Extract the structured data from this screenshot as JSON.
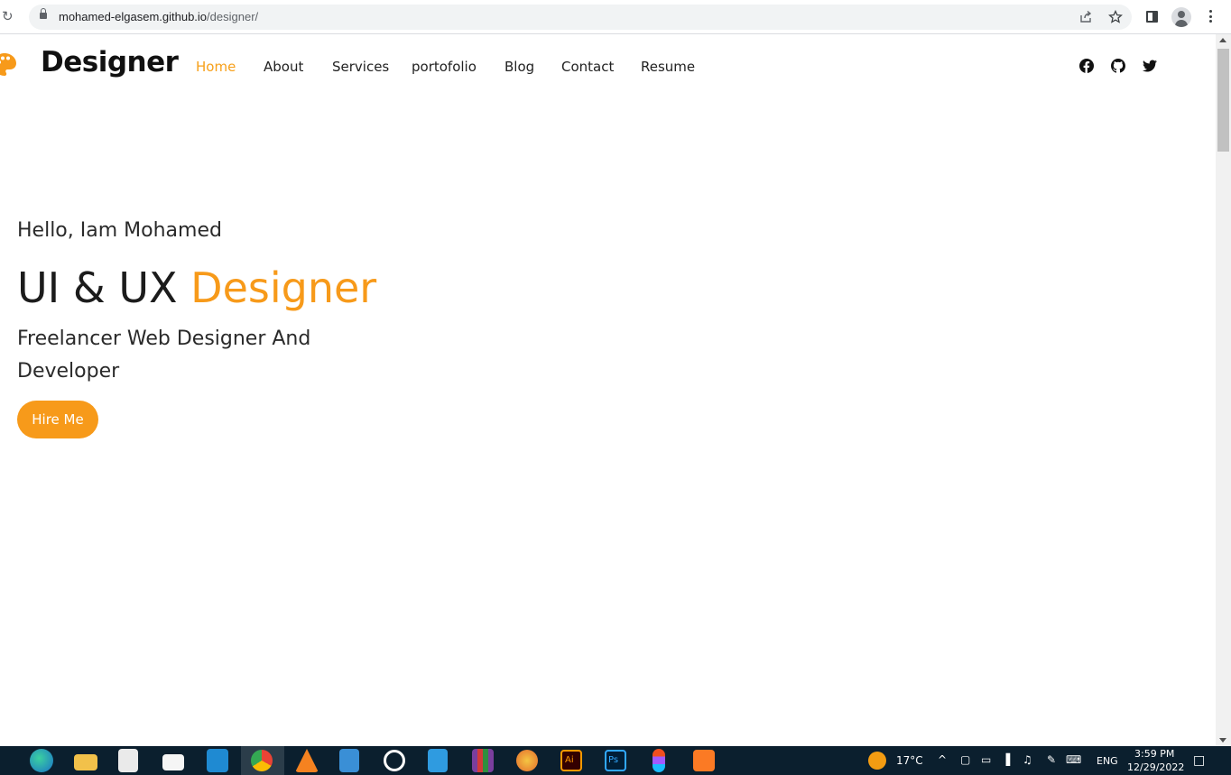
{
  "browser": {
    "url_host": "mohamed-elgasem.github.io",
    "url_path": "/designer/"
  },
  "site": {
    "logo": "Designer",
    "nav": [
      "Home",
      "About",
      "Services",
      "portofolio",
      "Blog",
      "Contact",
      "Resume"
    ],
    "active_nav": "Home",
    "social_icons": [
      "facebook-icon",
      "github-icon",
      "twitter-icon"
    ]
  },
  "hero": {
    "greeting": "Hello, Iam Mohamed",
    "headline_main": "UI & UX",
    "headline_accent": "Designer",
    "subtitle": "Freelancer Web Designer And Developer",
    "cta": "Hire Me"
  },
  "taskbar": {
    "weather": "17°C",
    "language": "ENG",
    "time": "3:59 PM",
    "date": "12/29/2022"
  },
  "colors": {
    "accent": "#f79a1a",
    "text": "#1c1c1c",
    "taskbar": "#0b1f2e"
  }
}
